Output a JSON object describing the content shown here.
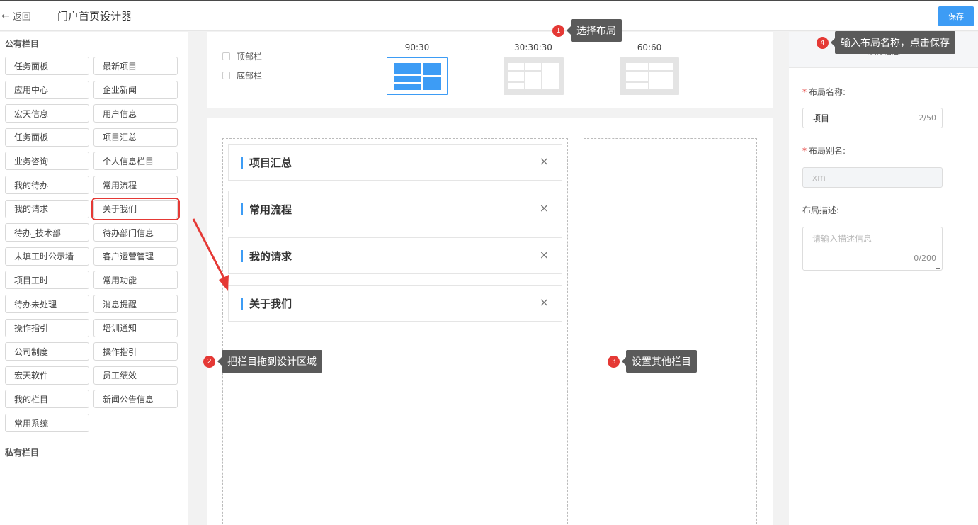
{
  "header": {
    "back_icon": "arrow-left-icon",
    "back_label": "返回",
    "title": "门户首页设计器",
    "save_label": "保存",
    "accent": "#3d9cf5"
  },
  "sidebar": {
    "public_title": "公有栏目",
    "private_title": "私有栏目",
    "items": [
      "任务面板",
      "最新项目",
      "应用中心",
      "企业新闻",
      "宏天信息",
      "用户信息",
      "任务面板",
      "项目汇总",
      "业务咨询",
      "个人信息栏目",
      "我的待办",
      "常用流程",
      "我的请求",
      "关于我们",
      "待办_技术部",
      "待办部门信息",
      "未填工时公示墙",
      "客户运营管理",
      "项目工时",
      "常用功能",
      "待办未处理",
      "消息提醒",
      "操作指引",
      "培训通知",
      "公司制度",
      "操作指引",
      "宏天软件",
      "员工绩效",
      "我的栏目",
      "新闻公告信息",
      "常用系统"
    ],
    "highlighted": "关于我们",
    "highlight_color": "#e53935"
  },
  "layout_bar": {
    "top_bar_label": "顶部栏",
    "bottom_bar_label": "底部栏",
    "options": [
      {
        "label": "90:30",
        "selected": true
      },
      {
        "label": "30:30:30",
        "selected": false
      },
      {
        "label": "60:60",
        "selected": false
      }
    ]
  },
  "canvas": {
    "left_column_widgets": [
      "项目汇总",
      "常用流程",
      "我的请求",
      "关于我们"
    ],
    "close_glyph": "×"
  },
  "right_panel": {
    "header": "布局信息",
    "name_label": "布局名称:",
    "name_value": "项目",
    "name_count": "2/50",
    "alias_label": "布局别名:",
    "alias_value": "xm",
    "desc_label": "布局描述:",
    "desc_placeholder": "请输入描述信息",
    "desc_count": "0/200",
    "required_mark": "*"
  },
  "annotations": [
    {
      "num": "1",
      "text": "选择布局"
    },
    {
      "num": "2",
      "text": "把栏目拖到设计区域"
    },
    {
      "num": "3",
      "text": "设置其他栏目"
    },
    {
      "num": "4",
      "text": "输入布局名称，点击保存"
    }
  ],
  "annotation_color": "#e53935"
}
